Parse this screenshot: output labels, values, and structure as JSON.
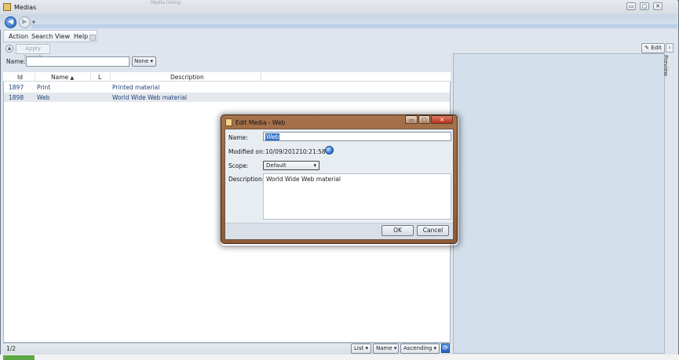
{
  "window": {
    "title": "Medias",
    "ghost_tab": "Media listing"
  },
  "window_controls": {
    "minimize": "▭",
    "maximize": "▢",
    "close": "✕"
  },
  "nav": {
    "back": "◀",
    "forward": "▶",
    "history": "▼"
  },
  "menu": [
    "Action",
    "Search",
    "View",
    "Help"
  ],
  "toolbar": {
    "apply_search": "Apply Search",
    "apply_icon": "▲"
  },
  "filter": {
    "name_label": "Name:",
    "name_value": "",
    "mode": "None"
  },
  "list": {
    "columns": [
      "Id",
      "Name",
      "L",
      "Description"
    ],
    "sort_indicator": "▲",
    "rows": [
      {
        "id": "1897",
        "name": "Print",
        "l": "",
        "description": "Printed material"
      },
      {
        "id": "1898",
        "name": "Web",
        "l": "",
        "description": "World Wide Web material"
      }
    ]
  },
  "status": {
    "count": "1/2",
    "view": "List",
    "sort_field": "Name",
    "sort_order": "Ascending",
    "refresh_icon": "⟳"
  },
  "preview": {
    "edit_button": "Edit",
    "collapse": "›",
    "label": "Preview"
  },
  "dialog": {
    "title": "Edit Media - Web",
    "name_label": "Name:",
    "name_value": "Web",
    "modified_label": "Modified on:",
    "modified_date": "10/09/2012",
    "modified_time": "10:21:58",
    "scope_label": "Scope:",
    "scope_value": "Default",
    "description_label": "Description:",
    "description_value": "World Wide Web material",
    "ok": "OK",
    "cancel": "Cancel"
  },
  "colors": {
    "dialog_frame": "#9a6542",
    "selection": "#3471c5",
    "preview_bg": "#d3dfea"
  }
}
